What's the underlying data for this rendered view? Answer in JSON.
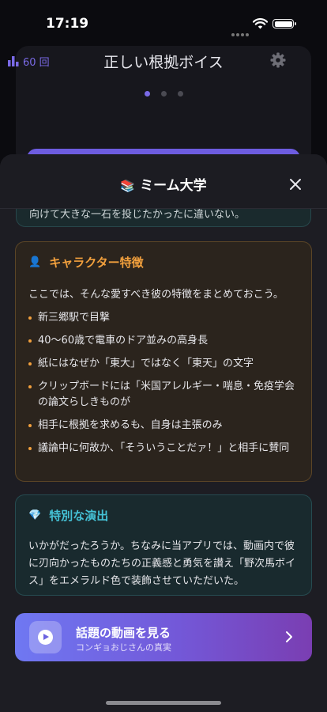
{
  "status_bar": {
    "time": "17:19"
  },
  "background_screen": {
    "play_count": "60 回",
    "title": "正しい根拠ボイス",
    "page_dots": 3,
    "active_dot": 0
  },
  "sheet": {
    "title": "ミーム大学",
    "title_icon": "books-icon",
    "previous_card_text": "向けて大きな一石を投じたかったに違いない。",
    "character_card": {
      "icon": "person-icon",
      "heading": "キャラクター特徴",
      "intro": "ここでは、そんな愛すべき彼の特徴をまとめておこう。",
      "items": [
        "新三郷駅で目撃",
        "40〜60歳で電車のドア並みの高身長",
        "紙にはなぜか「東大」ではなく「東天」の文字",
        "クリップボードには「米国アレルギー・喘息・免疫学会の論文らしきものが",
        "相手に根拠を求めるも、自身は主張のみ",
        "議論中に何故か、「そういうことだァ！」と相手に賛同"
      ]
    },
    "special_card": {
      "icon": "diamond-icon",
      "heading": "特別な演出",
      "text": "いかがだったろうか。ちなみに当アプリでは、動画内で彼に刃向かったものたちの正義感と勇気を讃え「野次馬ボイス」をエメラルド色で装飾させていただいた。"
    },
    "cta": {
      "title": "話題の動画を見る",
      "subtitle": "コンギョおじさんの真実"
    }
  },
  "colors": {
    "accent": "#7a6ae6",
    "character_accent": "#f2a03d",
    "special_accent": "#45c2d6"
  }
}
